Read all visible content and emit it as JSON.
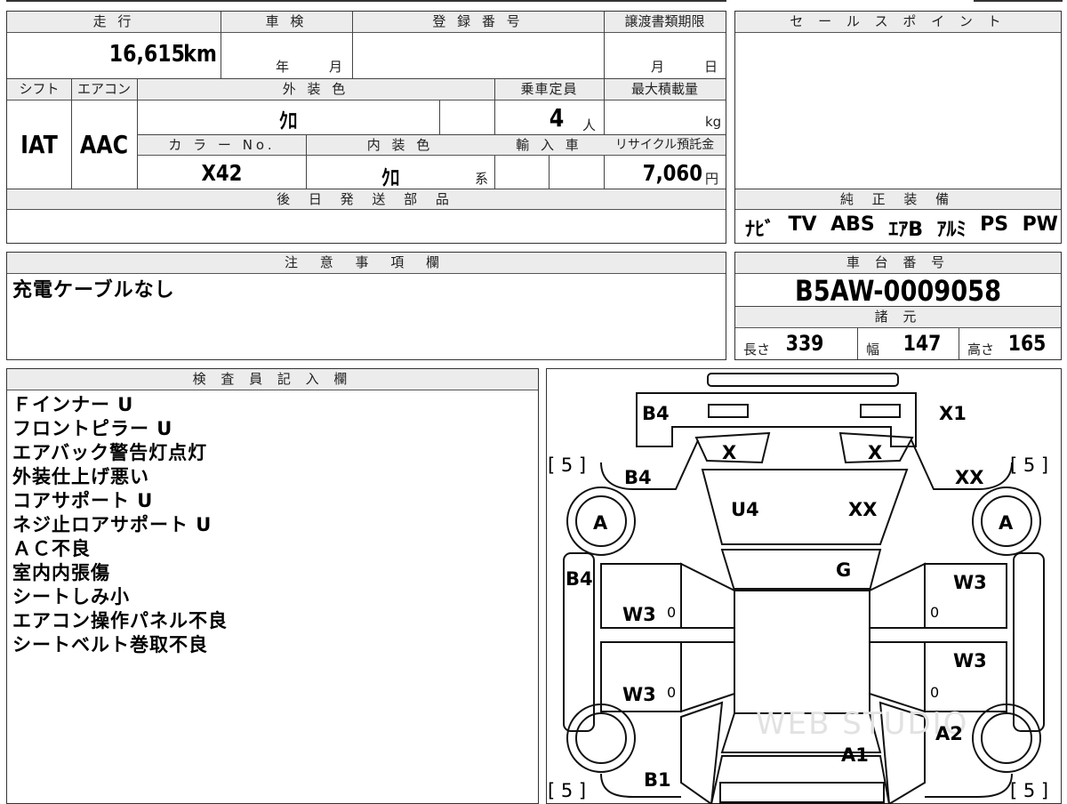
{
  "top_form": {
    "mileage": {
      "header": "走 行",
      "value": "16,615",
      "unit": "km"
    },
    "inspection": {
      "header": "車 検",
      "year_unit": "年",
      "month_unit": "月"
    },
    "registration": {
      "header": "登 録 番 号"
    },
    "transfer": {
      "header": "譲渡書類期限",
      "month_unit": "月",
      "day_unit": "日"
    },
    "shift": {
      "header": "シフト",
      "value": "IAT"
    },
    "aircon": {
      "header": "エアコン",
      "value": "AAC"
    },
    "exterior_color": {
      "header": "外 装 色",
      "value": "ｸﾛ"
    },
    "capacity": {
      "header": "乗車定員",
      "value": "4",
      "unit": "人"
    },
    "max_load": {
      "header": "最大積載量",
      "unit": "kg"
    },
    "color_no": {
      "header": "カ ラ ー No.",
      "value": "X42"
    },
    "interior_color": {
      "header": "内 装 色",
      "value": "ｸﾛ",
      "suffix": "系"
    },
    "import": {
      "header": "輸 入 車"
    },
    "recycle": {
      "header": "リサイクル預託金",
      "value": "7,060",
      "unit": "円"
    },
    "later_parts": {
      "header": "後 日 発 送 部 品"
    }
  },
  "sales_point": {
    "header": "セ ー ル ス ポ イ ン ト"
  },
  "equipment": {
    "header": "純 正 装 備",
    "items": [
      "ﾅﾋﾞ",
      "TV",
      "ABS",
      "ｴｱB",
      "ｱﾙﾐ",
      "PS",
      "PW"
    ]
  },
  "caution": {
    "header": "注 意 事 項 欄",
    "text": "充電ケーブルなし"
  },
  "chassis": {
    "header": "車 台 番 号",
    "value": "B5AW-0009058"
  },
  "specs": {
    "header": "諸 元",
    "length_label": "長さ",
    "length": "339",
    "width_label": "幅",
    "width": "147",
    "height_label": "高さ",
    "height": "165"
  },
  "inspector": {
    "header": "検 査 員 記 入 欄",
    "lines": [
      "Ｆインナー U",
      "フロントピラー U",
      "エアバック警告灯点灯",
      "外装仕上げ悪い",
      "コアサポート U",
      "ネジ止ロアサポート U",
      "ＡＣ不良",
      "室内内張傷",
      "シートしみ小",
      "エアコン操作パネル不良",
      "シートベルト巻取不良"
    ]
  },
  "diagram": {
    "marks": {
      "b4_top": "B4",
      "x1": "X1",
      "x_left": "X",
      "x_right": "X",
      "bracket_tl": "[ 5 ]",
      "bracket_tr": "[ 5 ]",
      "bracket_bl": "[ 5 ]",
      "bracket_br": "[ 5 ]",
      "b4_fender": "B4",
      "xx_right": "XX",
      "u4": "U4",
      "xx_hood": "XX",
      "a_left": "A",
      "a_right": "A",
      "g": "G",
      "b4_side": "B4",
      "w3_rf": "W3",
      "w3_lf": "W3",
      "zero_lf": "0",
      "zero_rf": "0",
      "w3_rr": "W3",
      "w3_lr": "W3",
      "zero_lr": "0",
      "zero_rr": "0",
      "a2": "A2",
      "a1": "A1",
      "b1": "B1"
    },
    "watermark": "WEB STUDIO"
  }
}
